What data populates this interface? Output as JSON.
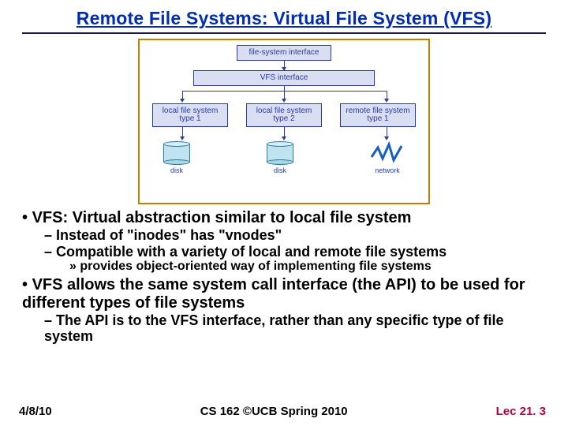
{
  "title": "Remote File Systems: Virtual File System (VFS)",
  "diagram": {
    "top": "file-system interface",
    "mid": "VFS interface",
    "row": [
      "local file system\ntype 1",
      "local file system\ntype 2",
      "remote file system\ntype 1"
    ],
    "bottom_labels": [
      "disk",
      "disk",
      "network"
    ]
  },
  "bullets": {
    "b1": "VFS: Virtual abstraction similar to local file system",
    "b1a": "Instead of \"inodes\" has \"vnodes\"",
    "b1b": "Compatible with a variety of local and remote file systems",
    "b1b1": "provides object-oriented way of implementing file systems",
    "b2": "VFS allows the same system call interface (the API) to be used for different types of file systems",
    "b2a": "The API is to the VFS interface, rather than any specific type of file system"
  },
  "footer": {
    "date": "4/8/10",
    "center": "CS 162 ©UCB Spring 2010",
    "right": "Lec 21. 3"
  }
}
